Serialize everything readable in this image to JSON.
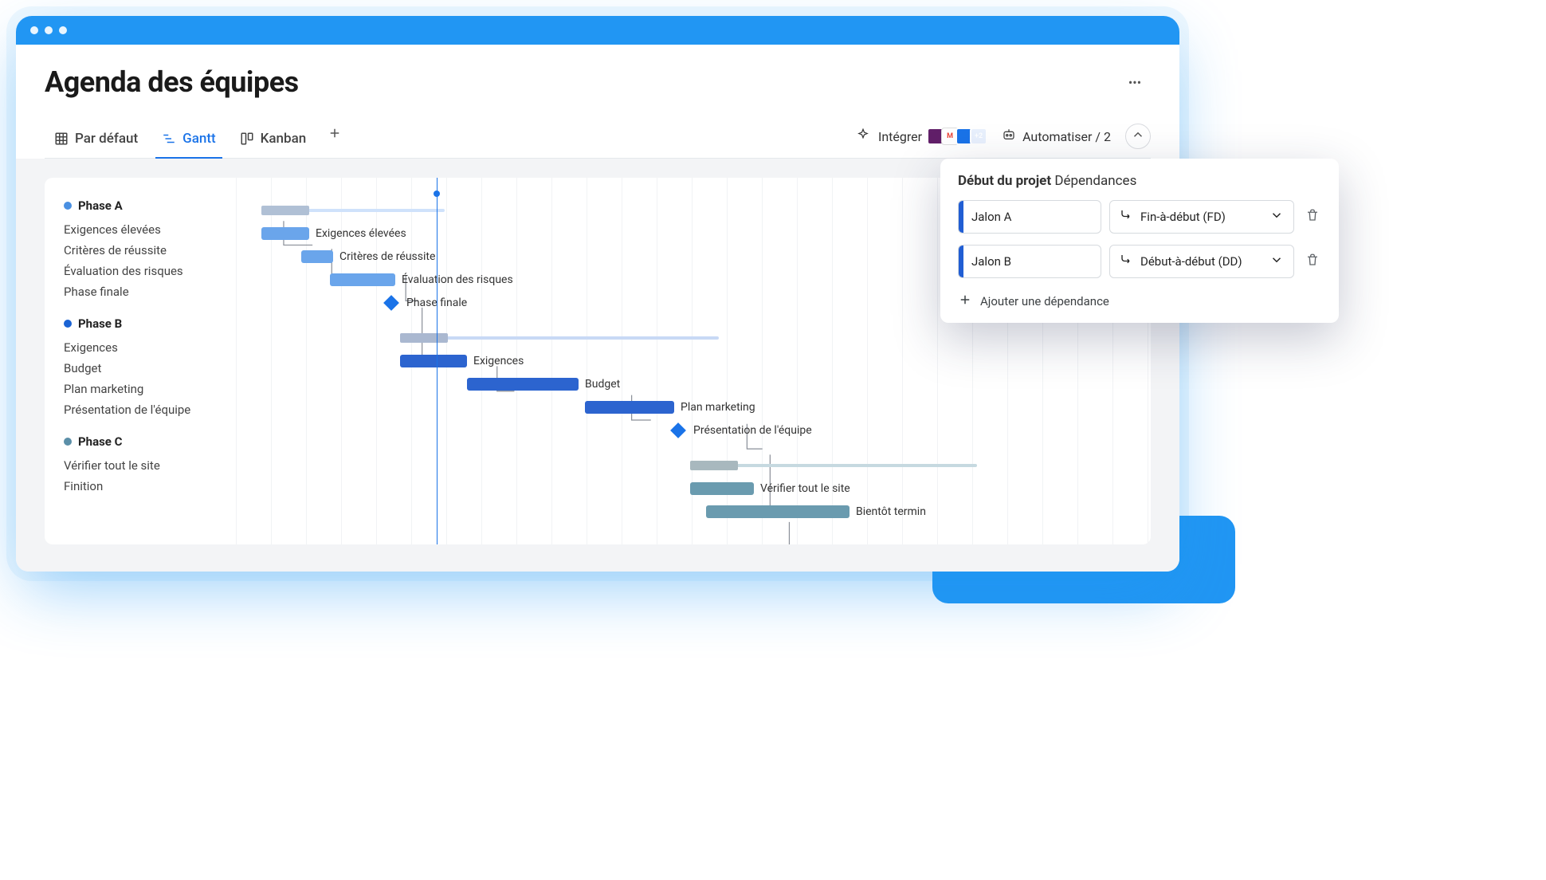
{
  "page": {
    "title": "Agenda des équipes"
  },
  "tabs": {
    "default": "Par défaut",
    "gantt": "Gantt",
    "kanban": "Kanban"
  },
  "toolbar": {
    "integrate": "Intégrer",
    "integrate_extra": "+2",
    "automate": "Automatiser / 2"
  },
  "phases": {
    "a": {
      "title": "Phase A",
      "items": [
        "Exigences élevées",
        "Critères de réussite",
        "Évaluation des risques",
        "Phase finale"
      ]
    },
    "b": {
      "title": "Phase B",
      "items": [
        "Exigences",
        "Budget",
        "Plan marketing",
        "Présentation de l'équipe"
      ]
    },
    "c": {
      "title": "Phase C",
      "items": [
        "Vérifier tout le site",
        "Finition"
      ]
    }
  },
  "gantt_labels": {
    "a0": "Exigences élevées",
    "a1": "Critères de réussite",
    "a2": "Évaluation des risques",
    "a3": "Phase finale",
    "b0": "Exigences",
    "b1": "Budget",
    "b2": "Plan marketing",
    "b3": "Présentation de l'équipe",
    "c0": "Vérifier tout le site",
    "c1": "Bientôt termin"
  },
  "popover": {
    "title_bold": "Début du projet",
    "title_rest": "Dépendances",
    "dep_a": "Jalon A",
    "dep_a_type": "Fin-à-début (FD)",
    "dep_b": "Jalon B",
    "dep_b_type": "Début-à-début (DD)",
    "add": "Ajouter une dépendance"
  },
  "chart_data": {
    "type": "gantt",
    "columns_visible": 22,
    "today_column": 6,
    "phases": [
      {
        "name": "Phase A",
        "color": "#5b96e3",
        "group_range": [
          1,
          6
        ],
        "tasks": [
          {
            "label": "Exigences élevées",
            "start": 1,
            "end": 2.3
          },
          {
            "label": "Critères de réussite",
            "start": 2.3,
            "end": 3.3
          },
          {
            "label": "Évaluation des risques",
            "start": 3.1,
            "end": 5
          },
          {
            "label": "Phase finale",
            "type": "milestone",
            "at": 5
          }
        ]
      },
      {
        "name": "Phase B",
        "color": "#2563cf",
        "group_range": [
          5.3,
          14
        ],
        "tasks": [
          {
            "label": "Exigences",
            "start": 5.3,
            "end": 7.2
          },
          {
            "label": "Budget",
            "start": 7.2,
            "end": 10.3
          },
          {
            "label": "Plan marketing",
            "start": 10.5,
            "end": 13
          },
          {
            "label": "Présentation de l'équipe",
            "type": "milestone",
            "at": 13
          }
        ]
      },
      {
        "name": "Phase C",
        "color": "#5b8fa8",
        "group_range": [
          13.3,
          22
        ],
        "tasks": [
          {
            "label": "Vérifier tout le site",
            "start": 13.3,
            "end": 15.2
          },
          {
            "label": "Bientôt termin",
            "start": 14.2,
            "end": 18.4
          }
        ]
      }
    ]
  }
}
